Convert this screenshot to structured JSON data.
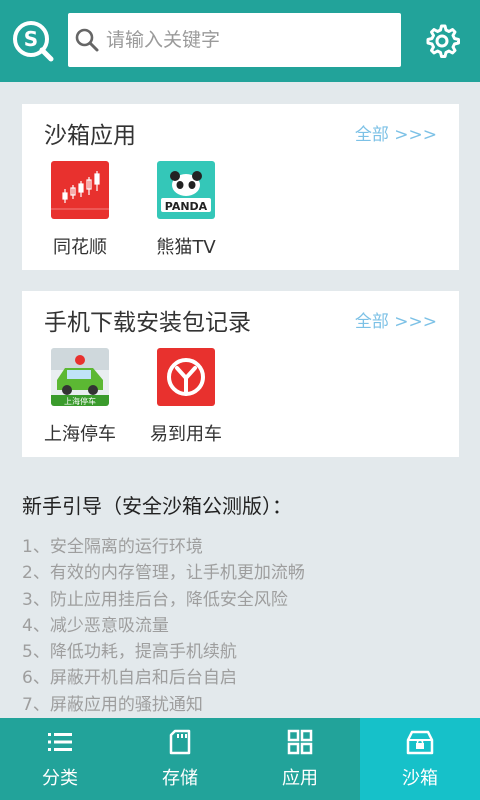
{
  "header": {
    "logo_icon": "sandbox-search-logo",
    "search_placeholder": "请输入关键字",
    "settings_icon": "gear-icon",
    "bg_color": "#22a39a"
  },
  "sandbox_apps": {
    "title": "沙箱应用",
    "more_label": "全部 >>>",
    "apps": [
      {
        "name": "同花顺",
        "icon": "stock-candlestick-icon"
      },
      {
        "name": "熊猫TV",
        "icon": "panda-tv-icon"
      }
    ]
  },
  "download_records": {
    "title": "手机下载安装包记录",
    "more_label": "全部 >>>",
    "apps": [
      {
        "name": "上海停车",
        "icon": "shanghai-parking-icon",
        "badge": "上海停车"
      },
      {
        "name": "易到用车",
        "icon": "yidao-car-icon"
      }
    ]
  },
  "guide": {
    "title": "新手引导（安全沙箱公测版）：",
    "items": [
      "1、安全隔离的运行环境",
      "2、有效的内存管理，让手机更加流畅",
      "3、防止应用挂后台，降低安全风险",
      "4、减少恶意吸流量",
      "5、降低功耗，提高手机续航",
      "6、屏蔽开机自启和后台自启",
      "7、屏蔽应用的骚扰通知"
    ]
  },
  "bottom_nav": {
    "items": [
      {
        "label": "分类",
        "icon": "list-icon"
      },
      {
        "label": "存储",
        "icon": "sd-card-icon"
      },
      {
        "label": "应用",
        "icon": "grid-icon"
      },
      {
        "label": "沙箱",
        "icon": "sandbox-box-icon",
        "active": true
      }
    ],
    "active_color": "#16c1c9"
  }
}
